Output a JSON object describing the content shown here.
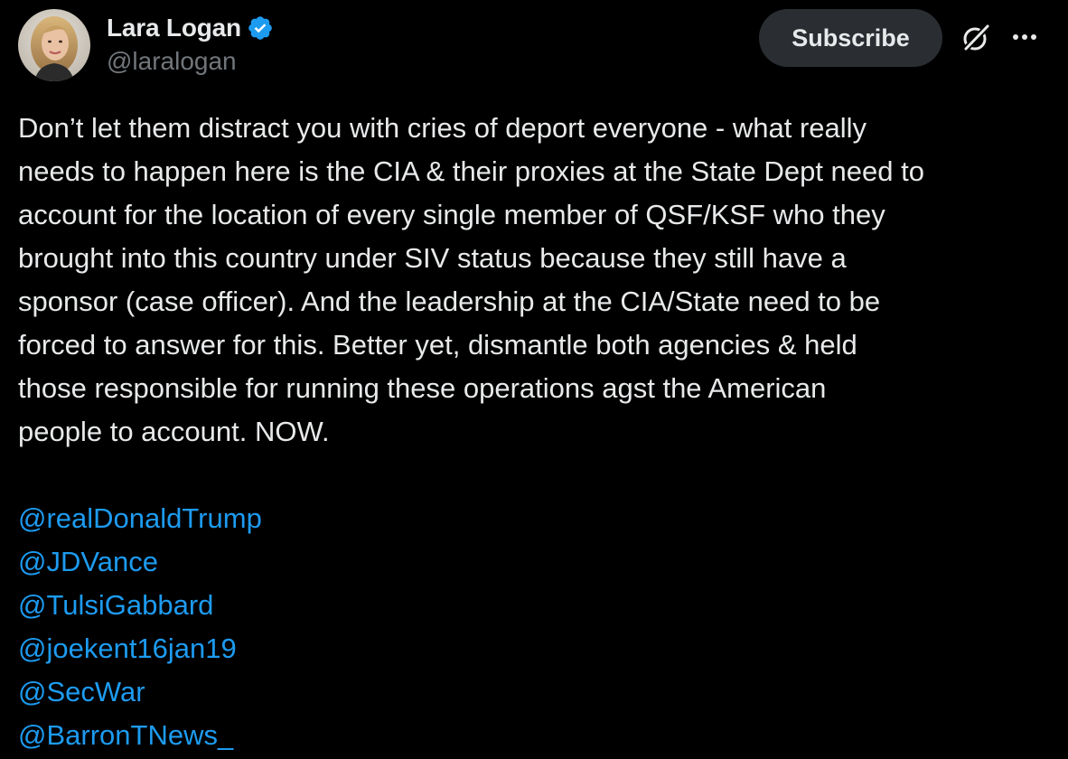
{
  "author": {
    "display_name": "Lara Logan",
    "handle": "@laralogan",
    "verified": true
  },
  "actions": {
    "subscribe_label": "Subscribe",
    "grok_icon": "grok-icon",
    "more_icon": "more-icon"
  },
  "post": {
    "text": "Don’t let them distract you with cries of deport everyone - what really\nneeds to happen here is the CIA & their proxies at the State Dept need to\naccount for the location of every single member of QSF/KSF who they\nbrought into this country under SIV status because they still have a\nsponsor (case officer). And the leadership at the CIA/State need to be\nforced to answer for this. Better yet, dismantle both agencies & held\nthose responsible for running these operations agst the American\npeople to account. NOW.",
    "mentions": [
      "@realDonaldTrump",
      "@JDVance",
      "@TulsiGabbard",
      "@joekent16jan19",
      "@SecWar",
      "@BarronTNews_"
    ]
  },
  "colors": {
    "background": "#000000",
    "text": "#e7e9ea",
    "muted": "#71767b",
    "link": "#1d9bf0",
    "verified": "#1d9bf0",
    "button_bg": "#2a2e33"
  }
}
